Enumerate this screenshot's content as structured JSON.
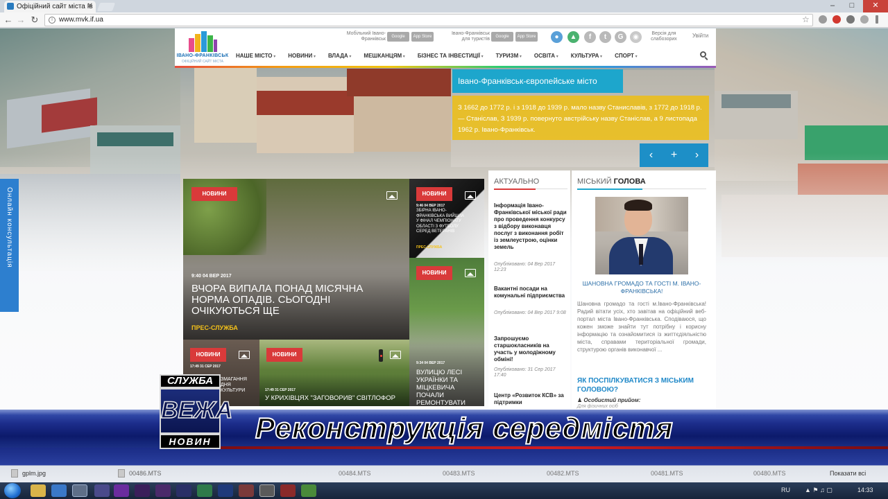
{
  "browser": {
    "tab_title": "Офіційний сайт міста Ів",
    "tab_close": "✕",
    "url": "www.mvk.if.ua",
    "window_controls": [
      "–",
      "□",
      "✕"
    ]
  },
  "site": {
    "logo_city": "ІВАНО-ФРАНКІВСЬК",
    "logo_sub": "ОФІЦІЙНИЙ САЙТ МІСТА",
    "mobile_label": "Мобільний Івано-Франківськ",
    "tourist_label": "Івано-Франківськ для туристів",
    "store_google": "Google play",
    "store_apple": "App Store",
    "accessibility": "Версія для слабозорих",
    "login": "Увійти",
    "nav": [
      "НАШЕ МІСТО",
      "НОВИНИ",
      "ВЛАДА",
      "МЕШКАНЦЯМ",
      "БІЗНЕС ТА ІНВЕСТИЦІЇ",
      "ТУРИЗМ",
      "ОСВІТА",
      "КУЛЬТУРА",
      "СПОРТ"
    ],
    "social_icons": [
      "facebook-icon",
      "twitter-icon",
      "google-plus-icon"
    ]
  },
  "hero": {
    "title": "Івано-Франківськ-європейське місто",
    "text": "З 1662 до 1772 р. і з 1918 до 1939 р. мало назву Станиславів, з 1772 до 1918 р. — Станіслав, З 1939 р. повернуто австрійську назву Станіслав, а 9 листопада 1962 р. Івано-Франківськ.",
    "prev": "‹",
    "add": "+",
    "next": "›"
  },
  "side_tab": "Онлайн консультація",
  "tiles": [
    {
      "badge": "НОВИНИ",
      "date": "9:40 04 ВЕР 2017",
      "title": "ВЧОРА ВИПАЛА ПОНАД МІСЯЧНА НОРМА ОПАДІВ. СЬОГОДНІ ОЧІКУЮТЬСЯ ЩЕ",
      "source": "ПРЕС-СЛУЖБА"
    },
    {
      "badge": "НОВИНИ",
      "date": "9:46 04 ВЕР 2017",
      "title": "ЗБІРНА ІВАНО-ФРАНКІВСЬКА ВИЙШЛА У ФІНАЛ ЧЕМПІОНАТУ ОБЛАСТІ З ФУТБОЛУ СЕРЕД ВЕТЕРАНІВ",
      "source": "ПРЕС-СЛУЖБА"
    },
    {
      "badge": "НОВИНИ",
      "date": "9:34 04 ВЕР 2017",
      "title": "ВУЛИЦЮ ЛЕСІ УКРАЇНКИ ТА МІЦКЕВИЧА ПОЧАЛИ РЕМОНТУВАТИ",
      "source": ""
    },
    {
      "badge": "НОВИНИ",
      "date": "17:49 31 СЕР 2017",
      "title": "ЗМАГАННЯ ДНЯ КУЛЬТУРИ",
      "source": ""
    },
    {
      "badge": "НОВИНИ",
      "date": "17:49 31 СЕР 2017",
      "title": "У КРИХІВЦЯХ \"ЗАГОВОРИВ\" СВІТЛОФОР",
      "source": ""
    }
  ],
  "actual": {
    "heading": "АКТУАЛЬНО",
    "items": [
      {
        "title": "Інформація Івано-Франківської міської ради про проведення конкурсу з відбору виконавця послуг з виконання робіт із землеустрою, оцінки земель",
        "date": "Опубліковано: 04 Вер 2017 12:23"
      },
      {
        "title": "Вакантні посади на комунальні підприємства",
        "date": "Опубліковано: 04 Вер 2017 9:08"
      },
      {
        "title": "Запрошуємо старшокласників на участь у молодіжному обміні!",
        "date": "Опубліковано: 31 Сер 2017 17:40"
      },
      {
        "title": "Центр «Розвиток КСВ» за підтримки",
        "date": ""
      }
    ]
  },
  "mayor": {
    "heading_light": "МІСЬКИЙ",
    "heading_bold": "ГОЛОВА",
    "greeting": "ШАНОВНА ГРОМАДО ТА ГОСТІ М. ІВАНО-ФРАНКІВСЬКА!",
    "text": "Шановна громадо та гості м.Івано-Франківська! Радий вітати усіх, хто завітав на офіційний веб-портал міста Івано-Франківська. Сподіваюся, що кожен зможе знайти тут потрібну і корисну інформацію та ознайомитися із життєдіяльністю міста, справами територіальної громади, структурою органів виконавчої ...",
    "contact_question": "ЯК ПОСПІЛКУВАТИСЯ З МІСЬКИМ ГОЛОВОЮ?",
    "reception": "Особистий прийом:",
    "reception_sub": "Для фізичних осіб"
  },
  "tv": {
    "logo_top": "СЛУЖБА",
    "logo_mid": "ВЕЖА",
    "logo_bottom": "НОВИН",
    "caption": "Реконструкція середмістя"
  },
  "downloads": {
    "items": [
      "gplm.jpg",
      "00486.MTS",
      "00484.MTS",
      "00483.MTS",
      "00482.MTS",
      "00481.MTS",
      "00480.MTS"
    ],
    "show_all": "Показати всі"
  },
  "taskbar": {
    "lang": "RU",
    "time": "14:33"
  },
  "colors": {
    "accent_blue": "#1da6cc",
    "hero_yellow": "#ecbe18",
    "badge_red": "#d93a3a",
    "tv_blue": "#1d2e8c"
  }
}
